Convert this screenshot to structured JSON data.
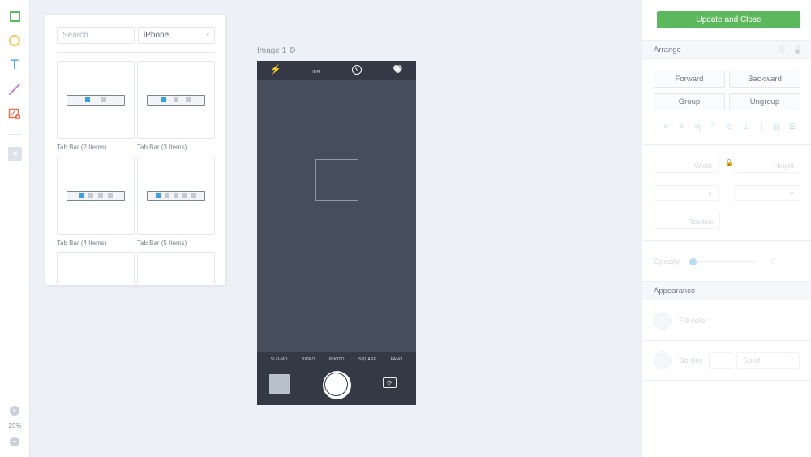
{
  "toolbar": {
    "tools": [
      {
        "name": "rectangle",
        "color": "#5cb85c"
      },
      {
        "name": "ellipse",
        "color": "#f2c94c"
      },
      {
        "name": "text",
        "glyph": "T",
        "color": "#3ba0dc"
      },
      {
        "name": "line",
        "color": "#c58ac7"
      },
      {
        "name": "image",
        "color": "#e9704f"
      }
    ],
    "close_glyph": "×",
    "zoom_in_glyph": "+",
    "zoom_out_glyph": "−",
    "zoom_level": "25%"
  },
  "library": {
    "search_placeholder": "Search",
    "device_selected": "iPhone",
    "caret": "▾",
    "tiles": [
      {
        "label": "Tab Bar (2 Items)",
        "items": 2
      },
      {
        "label": "Tab Bar (3 Items)",
        "items": 3
      },
      {
        "label": "Tab Bar (4 Items)",
        "items": 4
      },
      {
        "label": "Tab Bar (5 Items)",
        "items": 5
      },
      {
        "label": "",
        "items": 0
      },
      {
        "label": "",
        "items": 0
      }
    ]
  },
  "canvas": {
    "artboard_name": "Image 1",
    "gear_glyph": "⚙",
    "camera": {
      "flash_glyph": "⚡",
      "hdr_label": "HDR",
      "modes": [
        "SLO-MO",
        "VIDEO",
        "PHOTO",
        "SQUARE",
        "PANO"
      ],
      "flip_glyph": "⟳"
    }
  },
  "inspector": {
    "update_button": "Update and Close",
    "arrange": {
      "title": "Arrange",
      "trash_glyph": "🗑",
      "lock_glyph": "🔓",
      "buttons": [
        "Forward",
        "Backward",
        "Group",
        "Ungroup"
      ],
      "align_icons": [
        "align-left",
        "align-center-h",
        "align-right",
        "align-top",
        "align-middle-v",
        "align-bottom",
        "distribute-h",
        "distribute-v"
      ]
    },
    "dimensions": {
      "width_label": "Width",
      "height_label": "Height",
      "x_label": "X",
      "y_label": "Y",
      "rotation_label": "Rotation"
    },
    "opacity": {
      "label": "Opacity",
      "value": "0",
      "fraction": 0
    },
    "appearance": {
      "title": "Appearance",
      "fill_label": "Fill color",
      "border_label": "Border",
      "border_style": "Solid",
      "caret": "▾"
    }
  }
}
